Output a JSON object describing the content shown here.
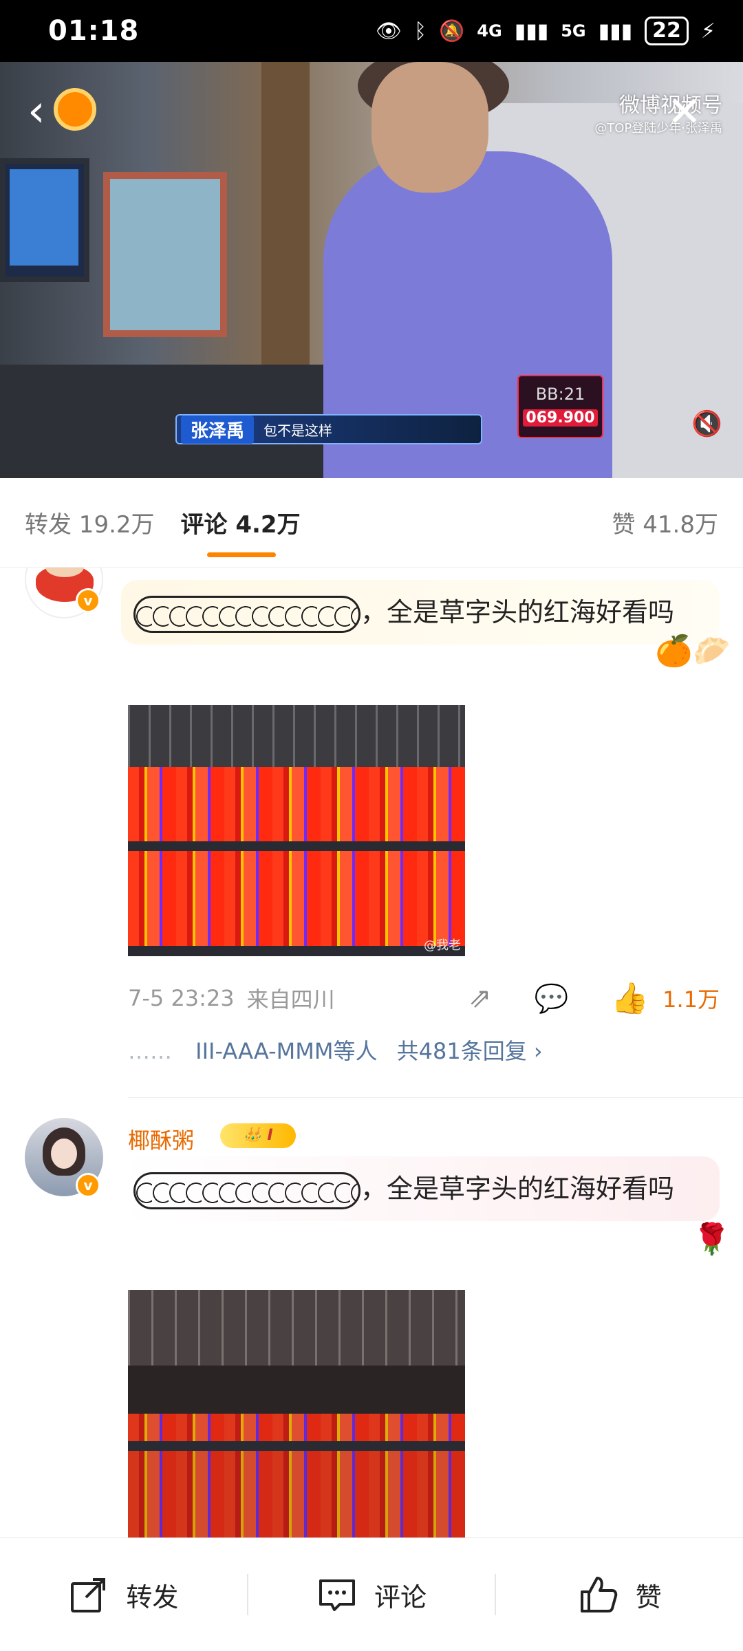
{
  "status_bar": {
    "time": "01:18",
    "net_4g": "4G",
    "net_5g": "5G",
    "battery": "22",
    "icons": [
      "eye-icon",
      "bluetooth-icon",
      "silent-icon",
      "signal-icon",
      "charging-icon"
    ]
  },
  "video": {
    "source_title": "微博视频号",
    "source_sub": "@TOP登陆少年·张泽禹",
    "caption_name": "张泽禹",
    "caption_line": "包不是这样",
    "score_time": "BB:21",
    "score_value": "069.900",
    "colors": {
      "caption_bg": "#1d3e86",
      "score_accent": "#e11b3a"
    }
  },
  "tabs": {
    "repost": "转发 19.2万",
    "comment": "评论 4.2万",
    "like": "赞 41.8万",
    "accent": "#ff8200"
  },
  "comments": [
    {
      "username": "",
      "text_suffix": "，全是草字头的红海好看吗",
      "time": "7-5 23:23",
      "source": "来自四川",
      "likes": "1.1万",
      "reply_users": "III-AAA-MMM等人",
      "reply_count": "共481条回复",
      "watermark": "@我老"
    },
    {
      "username": "椰酥粥",
      "vip_level": "I",
      "text_suffix": "，全是草字头的红海好看吗"
    }
  ],
  "bottom_bar": {
    "repost": "转发",
    "comment": "评论",
    "like": "赞"
  }
}
